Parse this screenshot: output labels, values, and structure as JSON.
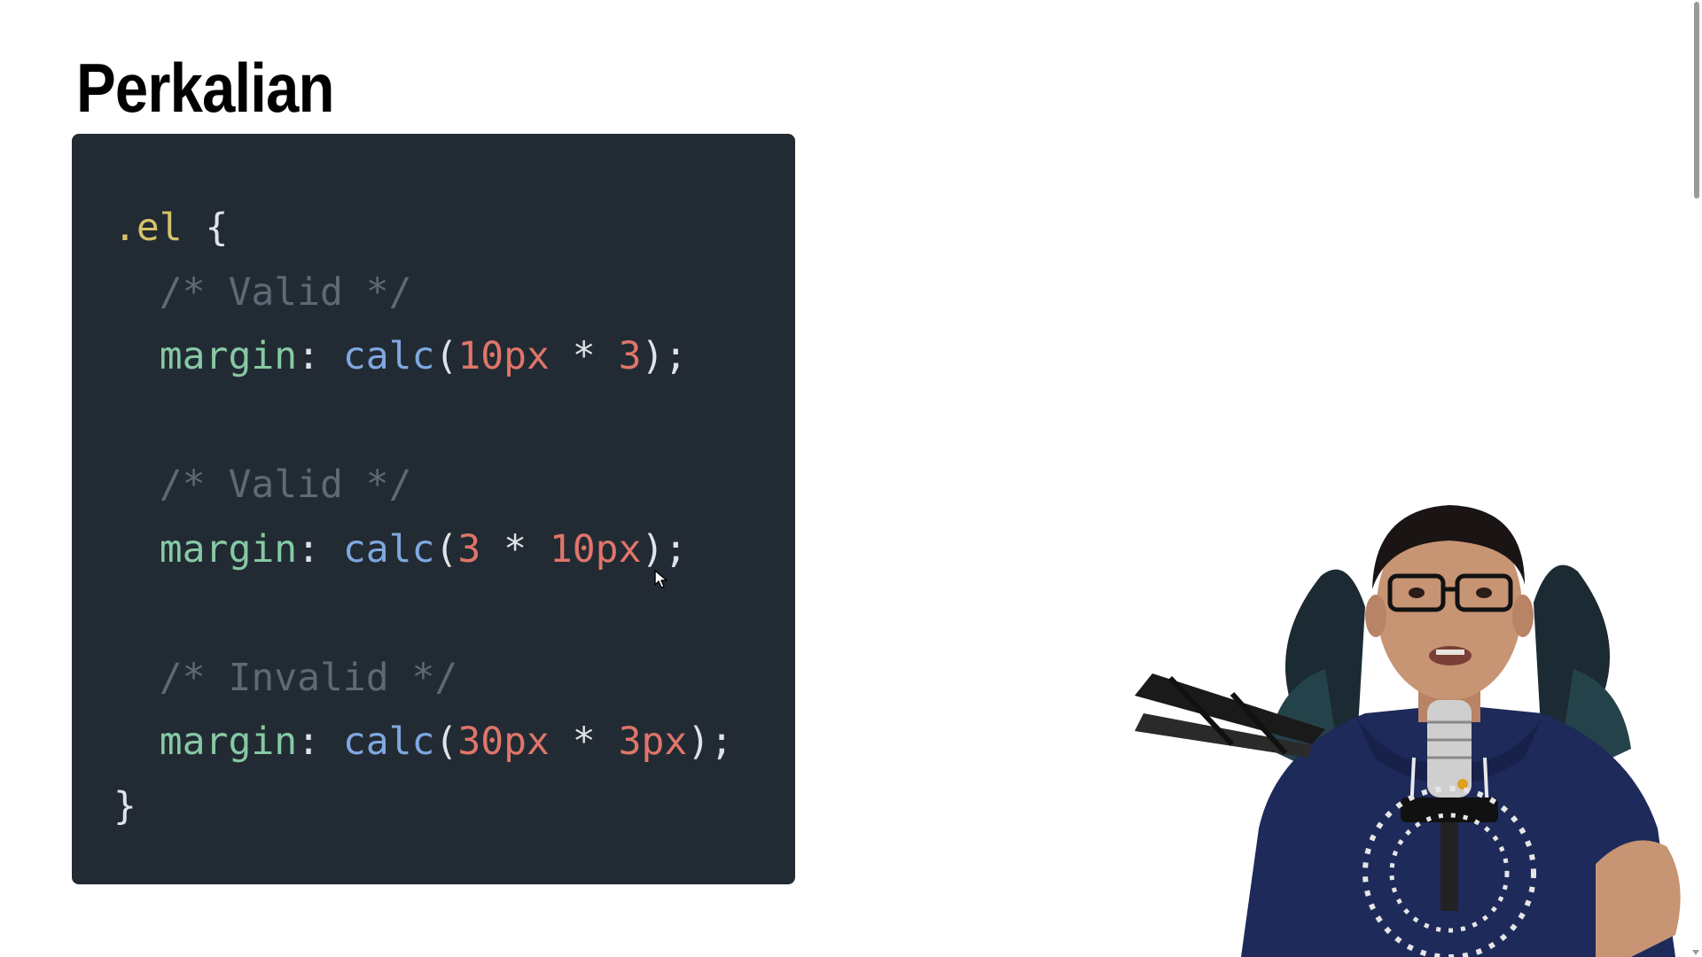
{
  "slide": {
    "title": "Perkalian"
  },
  "code": {
    "lines": [
      [
        {
          "t": ".el",
          "c": "selector"
        },
        {
          "t": " {",
          "c": "punct"
        }
      ],
      [
        {
          "t": "  /* Valid */",
          "c": "comment"
        }
      ],
      [
        {
          "t": "  margin",
          "c": "prop"
        },
        {
          "t": ": ",
          "c": "punct"
        },
        {
          "t": "calc",
          "c": "func"
        },
        {
          "t": "(",
          "c": "punct"
        },
        {
          "t": "10px",
          "c": "num"
        },
        {
          "t": " * ",
          "c": "punct"
        },
        {
          "t": "3",
          "c": "num"
        },
        {
          "t": ");",
          "c": "punct"
        }
      ],
      [],
      [
        {
          "t": "  /* Valid */",
          "c": "comment"
        }
      ],
      [
        {
          "t": "  margin",
          "c": "prop"
        },
        {
          "t": ": ",
          "c": "punct"
        },
        {
          "t": "calc",
          "c": "func"
        },
        {
          "t": "(",
          "c": "punct"
        },
        {
          "t": "3",
          "c": "num"
        },
        {
          "t": " * ",
          "c": "punct"
        },
        {
          "t": "10px",
          "c": "num"
        },
        {
          "t": ");",
          "c": "punct"
        }
      ],
      [],
      [
        {
          "t": "  /* Invalid */",
          "c": "comment"
        }
      ],
      [
        {
          "t": "  margin",
          "c": "prop"
        },
        {
          "t": ": ",
          "c": "punct"
        },
        {
          "t": "calc",
          "c": "func"
        },
        {
          "t": "(",
          "c": "punct"
        },
        {
          "t": "30px",
          "c": "num"
        },
        {
          "t": " * ",
          "c": "punct"
        },
        {
          "t": "3px",
          "c": "num"
        },
        {
          "t": ");",
          "c": "punct"
        }
      ],
      [
        {
          "t": "}",
          "c": "punct"
        }
      ]
    ]
  },
  "colors": {
    "panel_background": "#222b33",
    "selector": "#d6c26a",
    "comment": "#5d6a75",
    "property": "#86c9a4",
    "function": "#7fa8e0",
    "number": "#e0756a"
  },
  "icons": {
    "cursor": "mouse-pointer-icon"
  },
  "presenter": {
    "description_icon": "presenter-webcam"
  }
}
